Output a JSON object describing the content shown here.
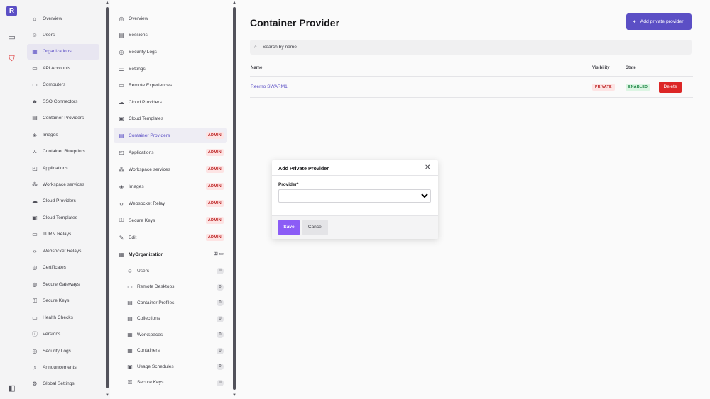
{
  "rail": {
    "logo": "R",
    "icons": [
      "monitor-icon",
      "shield-icon",
      "sidebar-toggle-icon"
    ]
  },
  "nav1": {
    "items": [
      {
        "label": "Overview",
        "icon": "⌂"
      },
      {
        "label": "Users",
        "icon": "☺"
      },
      {
        "label": "Organizations",
        "icon": "▦"
      },
      {
        "label": "API Accounts",
        "icon": "▭"
      },
      {
        "label": "Computers",
        "icon": "▭"
      },
      {
        "label": "SSO Connectors",
        "icon": "☻"
      },
      {
        "label": "Container Providers",
        "icon": "▤"
      },
      {
        "label": "Images",
        "icon": "◈"
      },
      {
        "label": "Container Blueprints",
        "icon": "⋏"
      },
      {
        "label": "Applications",
        "icon": "◰"
      },
      {
        "label": "Workspace services",
        "icon": "⁂"
      },
      {
        "label": "Cloud Providers",
        "icon": "☁"
      },
      {
        "label": "Cloud Templates",
        "icon": "▣"
      },
      {
        "label": "TURN Relays",
        "icon": "▭"
      },
      {
        "label": "Websocket Relays",
        "icon": "‹›"
      },
      {
        "label": "Certificates",
        "icon": "◎"
      },
      {
        "label": "Secure Gateways",
        "icon": "◍"
      },
      {
        "label": "Secure Keys",
        "icon": "⚿"
      },
      {
        "label": "Health Checks",
        "icon": "▭"
      },
      {
        "label": "Versions",
        "icon": "ⓘ"
      },
      {
        "label": "Security Logs",
        "icon": "◎"
      },
      {
        "label": "Announcements",
        "icon": "♫"
      },
      {
        "label": "Global Settings",
        "icon": "⚙"
      }
    ],
    "active_index": 2
  },
  "nav2": {
    "items": [
      {
        "label": "Overview",
        "icon": "◎",
        "badge": ""
      },
      {
        "label": "Sessions",
        "icon": "▤",
        "badge": ""
      },
      {
        "label": "Security Logs",
        "icon": "◎",
        "badge": ""
      },
      {
        "label": "Settings",
        "icon": "☰",
        "badge": ""
      },
      {
        "label": "Remote Experiences",
        "icon": "▭",
        "badge": ""
      },
      {
        "label": "Cloud Providers",
        "icon": "☁",
        "badge": ""
      },
      {
        "label": "Cloud Templates",
        "icon": "▣",
        "badge": ""
      },
      {
        "label": "Container Providers",
        "icon": "▤",
        "badge": "ADMIN"
      },
      {
        "label": "Applications",
        "icon": "◰",
        "badge": "ADMIN"
      },
      {
        "label": "Workspace services",
        "icon": "⁂",
        "badge": "ADMIN"
      },
      {
        "label": "Images",
        "icon": "◈",
        "badge": "ADMIN"
      },
      {
        "label": "Websocket Relay",
        "icon": "‹›",
        "badge": "ADMIN"
      },
      {
        "label": "Secure Keys",
        "icon": "⚿",
        "badge": "ADMIN"
      },
      {
        "label": "Edit",
        "icon": "✎",
        "badge": "ADMIN"
      }
    ],
    "active_index": 7,
    "org": {
      "label": "MyOrganization",
      "icon": "▦",
      "actions": "⚿ ▭"
    },
    "sub_items": [
      {
        "label": "Users",
        "icon": "☺",
        "count": "0"
      },
      {
        "label": "Remote Desktops",
        "icon": "▭",
        "count": "0"
      },
      {
        "label": "Container Profiles",
        "icon": "▤",
        "count": "0"
      },
      {
        "label": "Collections",
        "icon": "▤",
        "count": "0"
      },
      {
        "label": "Workspaces",
        "icon": "▦",
        "count": "0"
      },
      {
        "label": "Containers",
        "icon": "▦",
        "count": "0"
      },
      {
        "label": "Usage Schedules",
        "icon": "▣",
        "count": "0"
      },
      {
        "label": "Secure Keys",
        "icon": "⚿",
        "count": "0"
      }
    ]
  },
  "main": {
    "title": "Container Provider",
    "add_button": "Add private provider",
    "search_placeholder": "Search by name",
    "columns": {
      "name": "Name",
      "visibility": "Visibility",
      "state": "State"
    },
    "row": {
      "name": "Reemo SWARM1",
      "visibility": "PRIVATE",
      "state": "ENABLED",
      "delete": "Delete"
    }
  },
  "modal": {
    "title": "Add Private Provider",
    "field_label": "Provider*",
    "save": "Save",
    "cancel": "Cancel"
  },
  "colors": {
    "accent": "#5b4fc5",
    "danger": "#dc2626",
    "success": "#15803d"
  }
}
